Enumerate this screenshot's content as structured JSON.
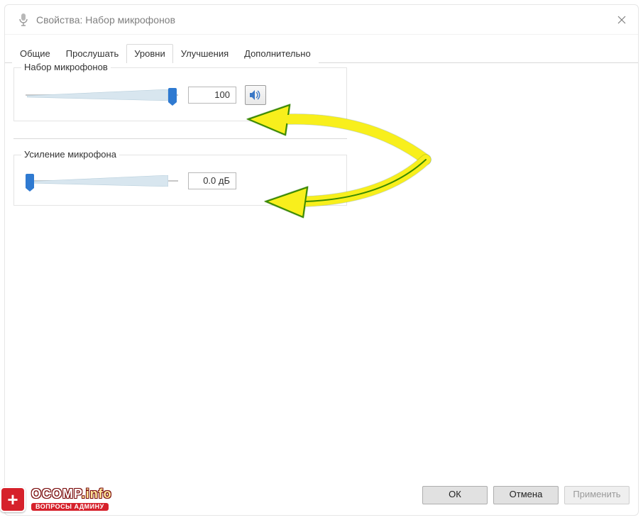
{
  "window": {
    "title": "Свойства: Набор микрофонов"
  },
  "tabs": [
    {
      "label": "Общие"
    },
    {
      "label": "Прослушать"
    },
    {
      "label": "Уровни"
    },
    {
      "label": "Улучшения"
    },
    {
      "label": "Дополнительно"
    }
  ],
  "active_tab_index": 2,
  "group1": {
    "title": "Набор микрофонов",
    "value": "100",
    "slider_percent": 100
  },
  "group2": {
    "title": "Усиление микрофона",
    "value": "0.0 дБ",
    "slider_percent": 0
  },
  "buttons": {
    "ok": "ОК",
    "cancel": "Отмена",
    "apply": "Применить"
  },
  "watermark": {
    "line1a": "OCOMP",
    "line1b": ".info",
    "line2": "ВОПРОСЫ АДМИНУ"
  }
}
